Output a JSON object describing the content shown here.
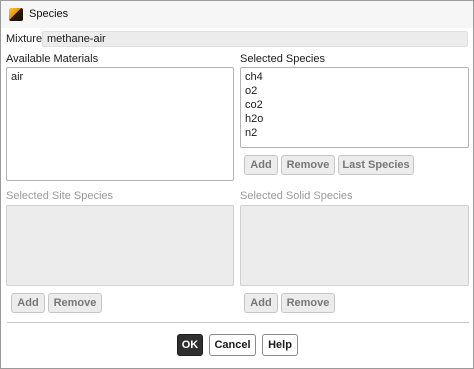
{
  "window": {
    "title": "Species",
    "icon": "fluent-app-icon"
  },
  "mixture": {
    "label": "Mixture",
    "value": "methane-air"
  },
  "available_materials": {
    "label": "Available Materials",
    "items": [
      "air"
    ]
  },
  "selected_species": {
    "label": "Selected Species",
    "items": [
      "ch4",
      "o2",
      "co2",
      "h2o",
      "n2"
    ],
    "buttons": {
      "add": "Add",
      "remove": "Remove",
      "last_species": "Last Species"
    }
  },
  "selected_site_species": {
    "label": "Selected Site Species",
    "buttons": {
      "add": "Add",
      "remove": "Remove"
    }
  },
  "selected_solid_species": {
    "label": "Selected Solid Species",
    "buttons": {
      "add": "Add",
      "remove": "Remove"
    }
  },
  "footer": {
    "ok": "OK",
    "cancel": "Cancel",
    "help": "Help"
  }
}
